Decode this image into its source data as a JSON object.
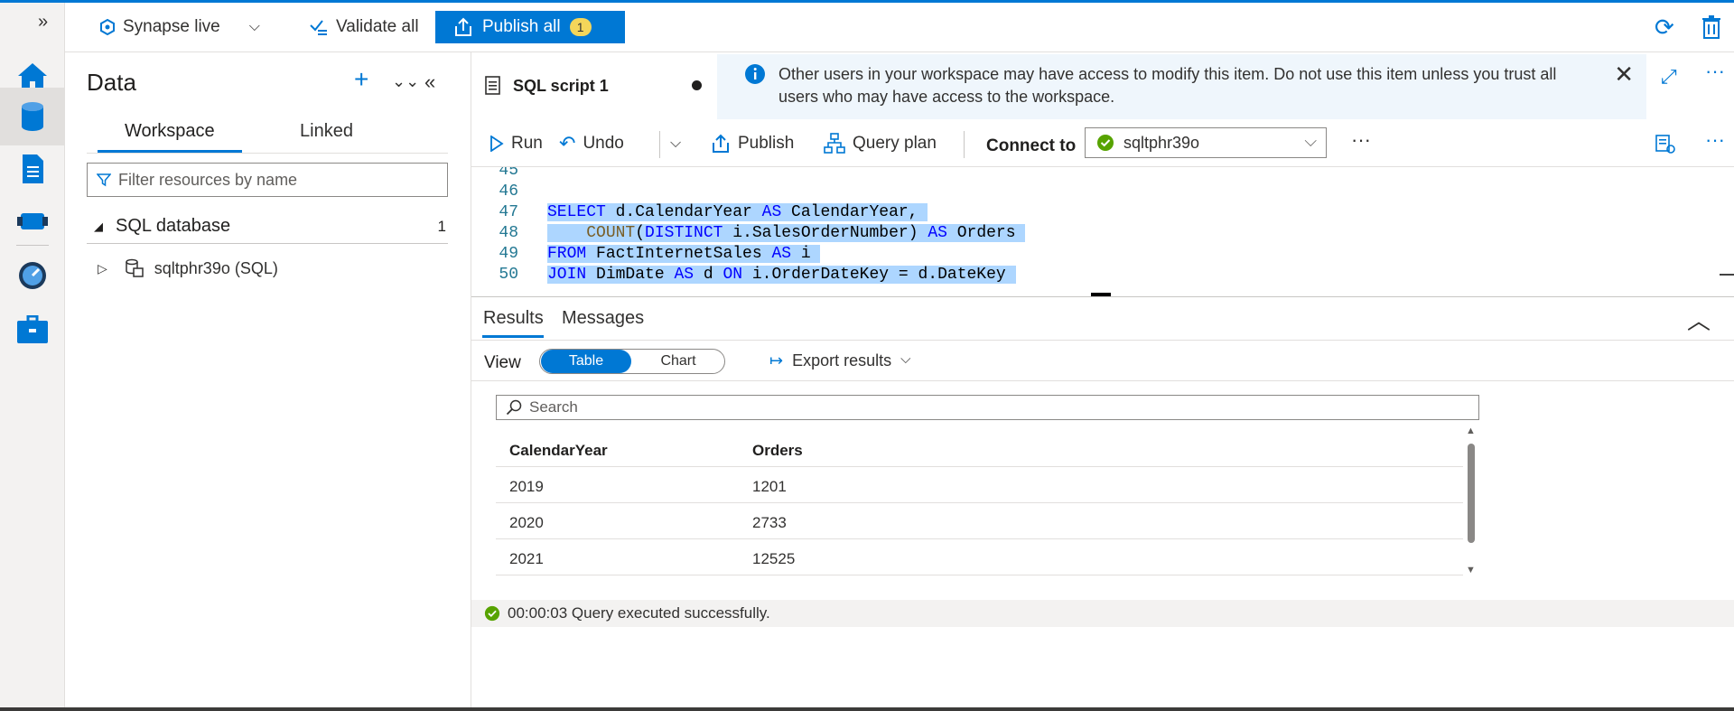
{
  "topbar": {
    "workspace_label": "Synapse live",
    "validate_label": "Validate all",
    "publish_label": "Publish all",
    "publish_count": "1"
  },
  "data_panel": {
    "title": "Data",
    "tabs": [
      "Workspace",
      "Linked"
    ],
    "filter_placeholder": "Filter resources by name",
    "section_label": "SQL database",
    "section_count": "1",
    "item_label": "sqltphr39o (SQL)"
  },
  "editor": {
    "tab_title": "SQL script 1",
    "info_message": "Other users in your workspace may have access to modify this item. Do not use this item unless you trust all users who may have access to the workspace.",
    "toolbar": {
      "run": "Run",
      "undo": "Undo",
      "publish": "Publish",
      "query_plan": "Query plan",
      "connect_label": "Connect to",
      "connect_value": "sqltphr39o"
    },
    "line_numbers": [
      "45",
      "46",
      "47",
      "48",
      "49",
      "50"
    ]
  },
  "results": {
    "tabs": [
      "Results",
      "Messages"
    ],
    "view_label": "View",
    "view_options": [
      "Table",
      "Chart"
    ],
    "export_label": "Export results",
    "search_placeholder": "Search",
    "columns": [
      "CalendarYear",
      "Orders"
    ],
    "rows": [
      [
        "2019",
        "1201"
      ],
      [
        "2020",
        "2733"
      ],
      [
        "2021",
        "12525"
      ]
    ],
    "status": "00:00:03 Query executed successfully."
  },
  "colors": {
    "accent": "#0078d4",
    "selection": "#add6ff",
    "success": "#57a300",
    "badge": "#f4d65a"
  }
}
